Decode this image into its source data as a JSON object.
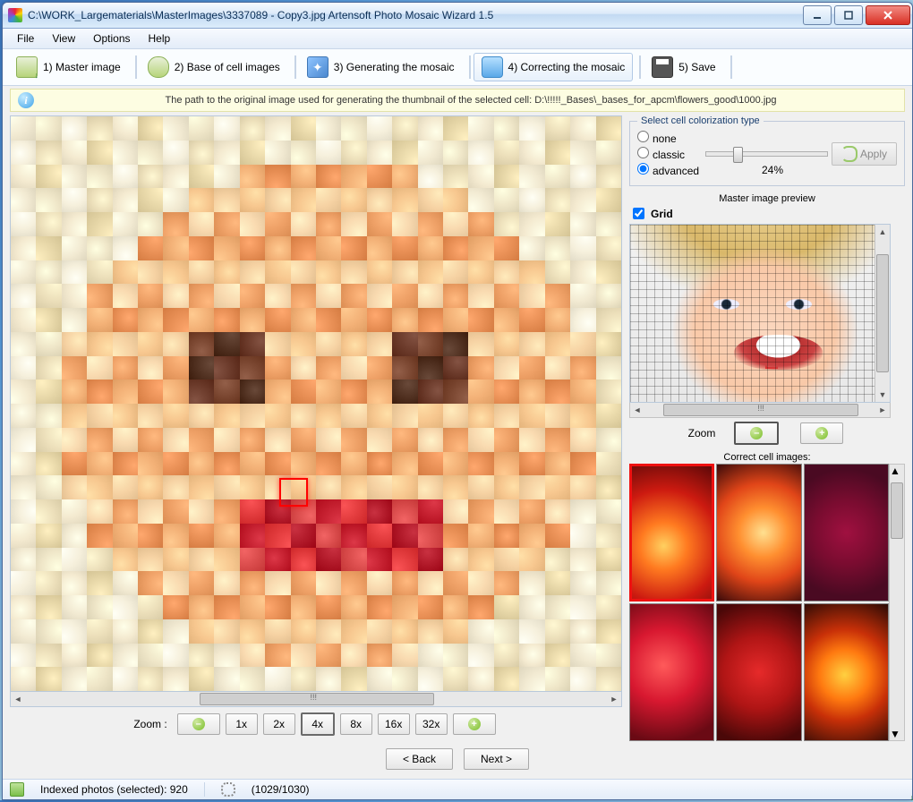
{
  "title": "C:\\WORK_Largematerials\\MasterImages\\3337089 - Copy3.jpg Artensoft Photo Mosaic Wizard 1.5",
  "menu": {
    "file": "File",
    "view": "View",
    "options": "Options",
    "help": "Help"
  },
  "steps": {
    "master": "1) Master image",
    "base": "2) Base of cell images",
    "gen": "3) Generating the mosaic",
    "correct": "4) Correcting the mosaic",
    "save": "5) Save"
  },
  "infobar": "The path to the original image used for generating the thumbnail of the selected cell: D:\\!!!!!_Bases\\_bases_for_apcm\\flowers_good\\1000.jpg",
  "zoom": {
    "label": "Zoom  :",
    "b1x": "1x",
    "b2x": "2x",
    "b4x": "4x",
    "b8x": "8x",
    "b16x": "16x",
    "b32x": "32x"
  },
  "colorize": {
    "legend": "Select cell colorization type",
    "none": "none",
    "classic": "classic",
    "advanced": "advanced",
    "percent": "24%",
    "apply": "Apply"
  },
  "preview": {
    "title": "Master image preview",
    "grid": "Grid",
    "zoom": "Zoom"
  },
  "cells": {
    "title": "Correct cell images:"
  },
  "nav": {
    "back": "<  Back",
    "next": "Next  >"
  },
  "status": {
    "indexed": "Indexed photos (selected): 920",
    "progress": "(1029/1030)"
  },
  "scroll_marker": "!!!"
}
